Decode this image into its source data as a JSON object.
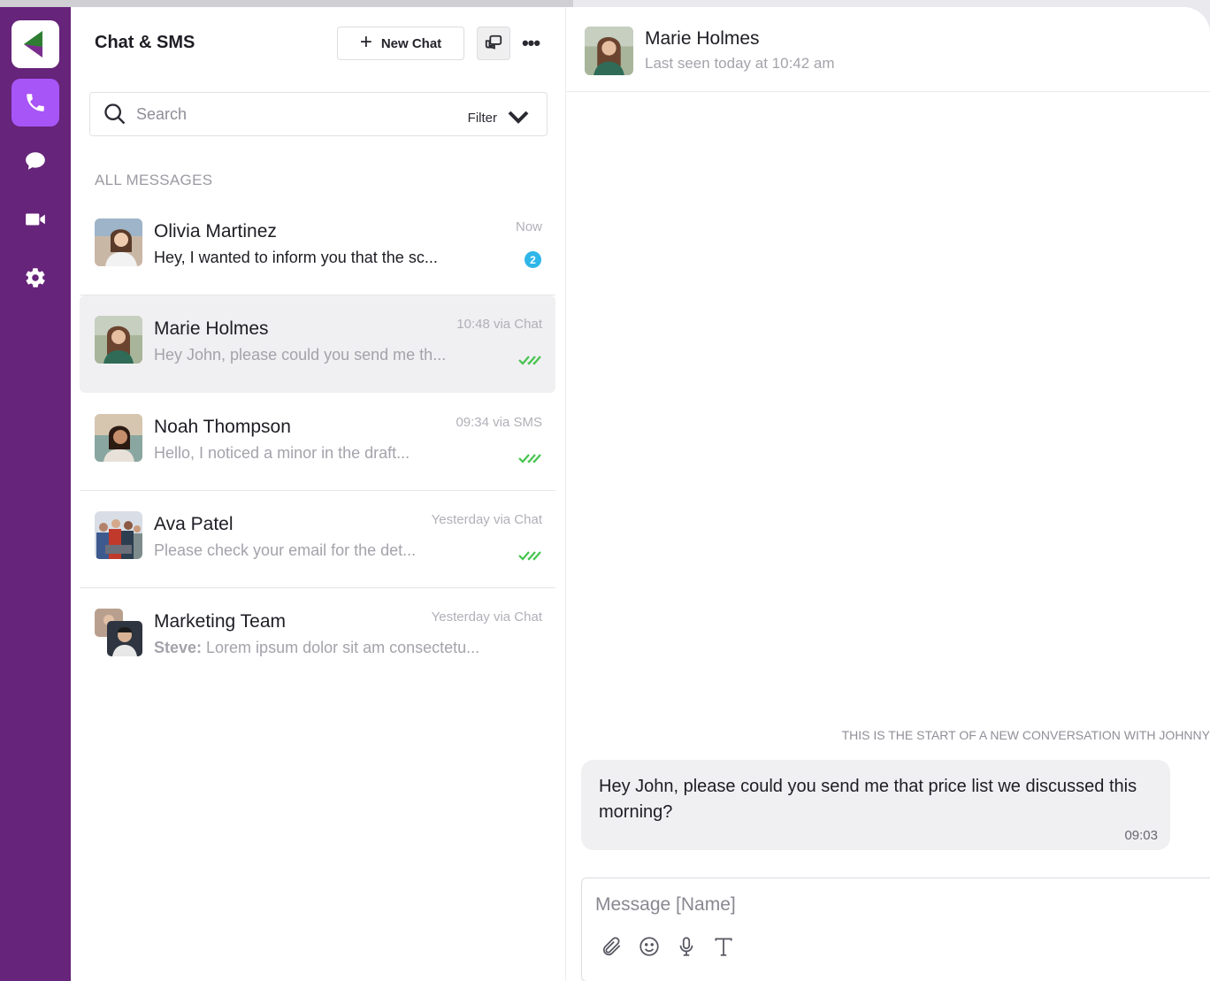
{
  "app": {
    "title": "Chat & SMS",
    "brand_color": "#66247a",
    "accent_color": "#a855f7"
  },
  "rail": {
    "items": [
      {
        "icon": "phone-icon",
        "active": true
      },
      {
        "icon": "chat-bubble-icon",
        "active": false
      },
      {
        "icon": "video-camera-icon",
        "active": false
      },
      {
        "icon": "gear-icon",
        "active": false
      }
    ]
  },
  "toolbar": {
    "new_chat_label": "New Chat"
  },
  "search": {
    "placeholder": "Search",
    "filter_label": "Filter"
  },
  "section_label": "ALL MESSAGES",
  "conversations": [
    {
      "name": "Olivia Martinez",
      "preview": "Hey, I wanted to inform you that the sc...",
      "meta": "Now",
      "unread_count": "2"
    },
    {
      "name": "Marie Holmes",
      "preview": "Hey John, please could you send me th...",
      "meta": "10:48 via Chat",
      "selected": true
    },
    {
      "name": "Noah Thompson",
      "preview": "Hello, I noticed a minor in the draft...",
      "meta": "09:34 via SMS"
    },
    {
      "name": "Ava Patel",
      "preview": "Please check your email for the det...",
      "meta": "Yesterday via Chat"
    },
    {
      "name": "Marketing Team",
      "preview_sender": "Steve:",
      "preview": " Lorem ipsum dolor sit am consectetu...",
      "meta": "Yesterday via Chat"
    }
  ],
  "chat": {
    "contact_name": "Marie Holmes",
    "status": "Last seen today at 10:42 am",
    "conversation_start": "THIS IS THE START OF A NEW CONVERSATION WITH JOHNNY",
    "messages": [
      {
        "text": "Hey John, please could you send me that price list we discussed this morning?",
        "time": "09:03"
      }
    ],
    "composer_placeholder": "Message [Name]"
  }
}
